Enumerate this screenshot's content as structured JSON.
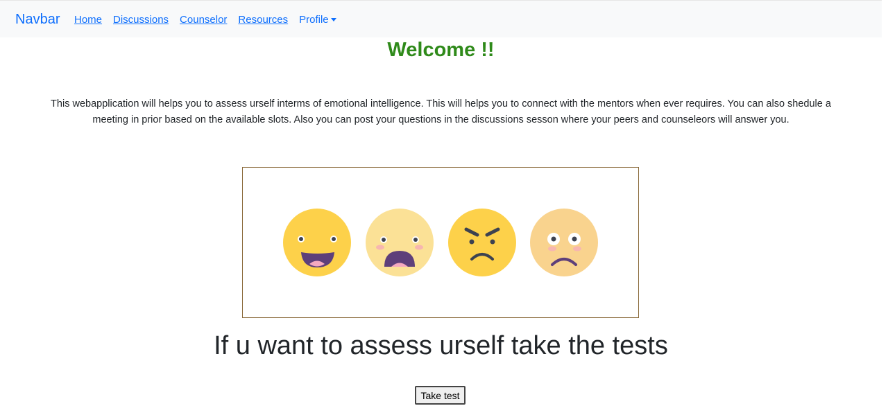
{
  "navbar": {
    "brand": "Navbar",
    "links": [
      "Home",
      "Discussions",
      "Counselor",
      "Resources"
    ],
    "profile_label": "Profile"
  },
  "main": {
    "welcome": "Welcome !!",
    "intro": "This webapplication will helps you to assess urself interms of emotional intelligence. This will helps you to connect with the mentors when ever requires. You can also shedule a meeting in prior based on the available slots. Also you can post your questions in the discussions sesson where your peers and counseleors will answer you.",
    "cta_heading": "If u want to assess urself take the tests",
    "take_test_label": "Take test"
  },
  "emojis": [
    {
      "name": "laughing-face-icon",
      "color": "#fdd14a"
    },
    {
      "name": "shocked-face-icon",
      "color": "#fbe196"
    },
    {
      "name": "angry-face-icon",
      "color": "#fdd14a"
    },
    {
      "name": "worried-face-icon",
      "color": "#f9d38e"
    }
  ],
  "colors": {
    "brand": "#0d6efd",
    "welcome": "#2f8a1a",
    "navbar_bg": "#f8f9fa",
    "frame_border": "#8a6a3a"
  }
}
